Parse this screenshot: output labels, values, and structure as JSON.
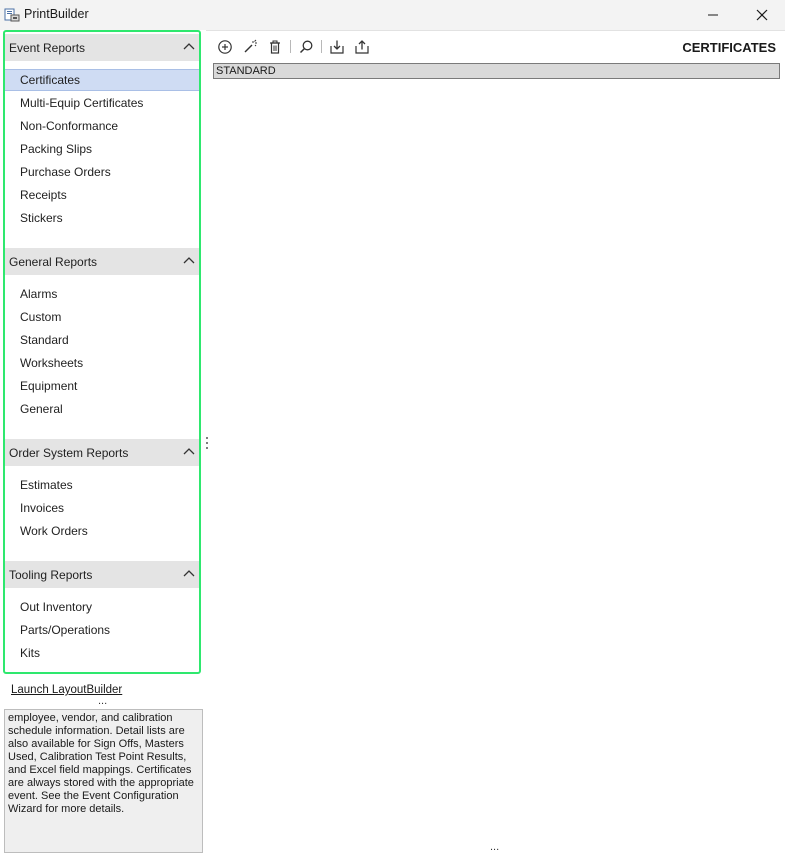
{
  "window": {
    "title": "PrintBuilder"
  },
  "sections": [
    {
      "title": "Event Reports",
      "items": [
        "Certificates",
        "Multi-Equip Certificates",
        "Non-Conformance",
        "Packing Slips",
        "Purchase Orders",
        "Receipts",
        "Stickers"
      ]
    },
    {
      "title": "General Reports",
      "items": [
        "Alarms",
        "Custom",
        "Standard",
        "Worksheets",
        "Equipment",
        "General"
      ]
    },
    {
      "title": "Order System Reports",
      "items": [
        "Estimates",
        "Invoices",
        "Work Orders"
      ]
    },
    {
      "title": "Tooling Reports",
      "items": [
        "Out Inventory",
        "Parts/Operations",
        "Kits"
      ]
    }
  ],
  "selected_item": "Certificates",
  "launch_link": "Launch LayoutBuilder",
  "ellipsis": "...",
  "description": "employee, vendor, and calibration schedule information. Detail lists are also available for Sign Offs, Masters Used, Calibration Test Point Results, and Excel field mappings. Certificates are always stored with the appropriate event. See the Event Configuration Wizard for more details.",
  "main": {
    "heading": "CERTIFICATES",
    "rows": [
      "STANDARD"
    ]
  },
  "toolbar": {
    "icons": [
      "add-icon",
      "wand-icon",
      "trash-icon",
      "search-icon",
      "import-icon",
      "export-icon"
    ]
  },
  "colors": {
    "accent_frame": "#2ee86e",
    "selection": "#cfdcf3",
    "section_header": "#e4e4e4"
  }
}
